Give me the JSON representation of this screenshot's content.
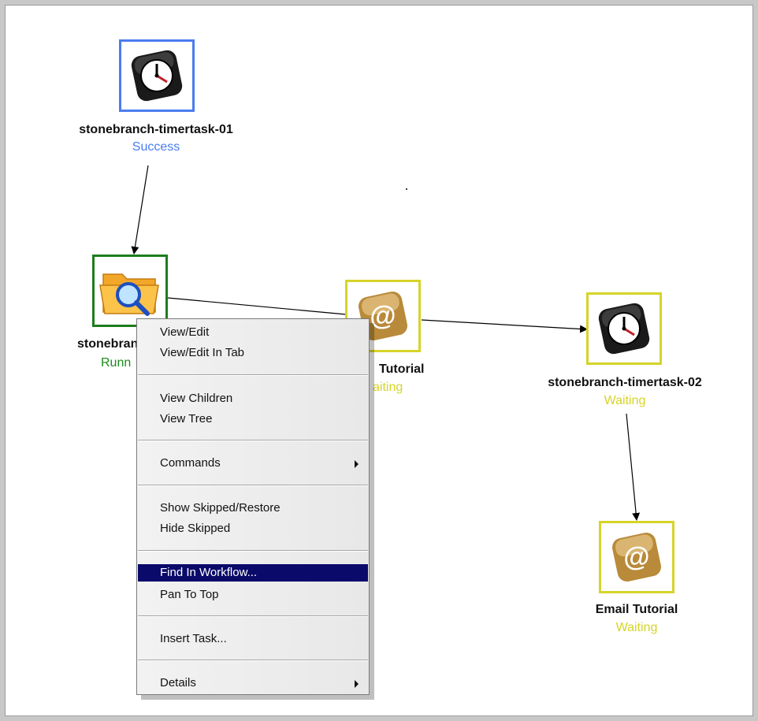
{
  "nodes": {
    "timer1": {
      "name": "stonebranch-timertask-01",
      "status": "Success",
      "icon": "clock-icon"
    },
    "file_monitor": {
      "name": "stonebranch-f",
      "status": "Runn",
      "icon": "folder-search-icon"
    },
    "email1": {
      "name": "Tutorial",
      "status": "aiting",
      "icon": "email-icon"
    },
    "timer2": {
      "name": "stonebranch-timertask-02",
      "status": "Waiting",
      "icon": "clock-icon"
    },
    "email2": {
      "name": "Email Tutorial",
      "status": "Waiting",
      "icon": "email-icon"
    }
  },
  "status_colors": {
    "success": "#4a7cf0",
    "running": "#1d8a1d",
    "waiting": "#d6d428"
  },
  "context_menu": {
    "items": [
      {
        "label": "View/Edit"
      },
      {
        "label": "View/Edit In Tab"
      },
      {
        "label": "View Children"
      },
      {
        "label": "View Tree"
      },
      {
        "label": "Commands",
        "submenu": true
      },
      {
        "label": "Show Skipped/Restore"
      },
      {
        "label": "Hide Skipped"
      },
      {
        "label": "Find In Workflow...",
        "highlighted": true
      },
      {
        "label": "Pan To Top"
      },
      {
        "label": "Insert Task..."
      },
      {
        "label": "Details",
        "submenu": true
      }
    ]
  }
}
